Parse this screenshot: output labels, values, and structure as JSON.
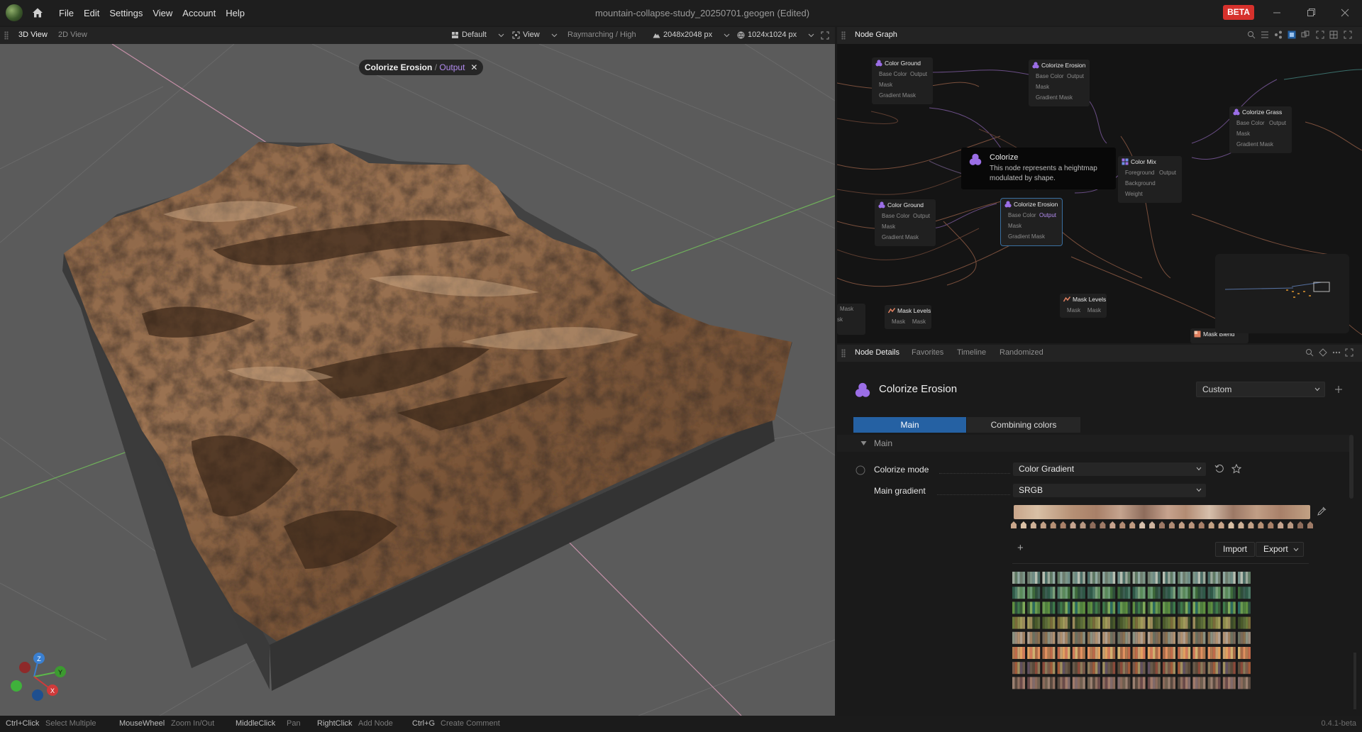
{
  "app": {
    "menu": [
      "File",
      "Edit",
      "Settings",
      "View",
      "Account",
      "Help"
    ],
    "document_title": "mountain-collapse-study_20250701.geogen (Edited)",
    "beta_badge": "BETA",
    "version": "0.4.1-beta"
  },
  "viewport_toolbar": {
    "tabs": [
      "3D View",
      "2D View"
    ],
    "camera_preset": "Default",
    "view_menu": "View",
    "render_mode": "Raymarching / High",
    "terrain_resolution": "2048x2048 px",
    "texture_resolution": "1024x1024 px"
  },
  "viewport": {
    "breadcrumb_node": "Colorize Erosion",
    "breadcrumb_sep": "/",
    "breadcrumb_port": "Output",
    "axes": {
      "z": "Z",
      "y": "Y",
      "x": "X"
    }
  },
  "node_graph": {
    "title": "Node Graph",
    "nodes": [
      {
        "title": "Color Ground",
        "rows": [
          "Base Color",
          "Mask",
          "Gradient Mask"
        ],
        "output": "Output"
      },
      {
        "title": "Colorize Erosion",
        "rows": [
          "Base Color",
          "Mask",
          "Gradient Mask"
        ],
        "output": "Output"
      },
      {
        "title": "Colorize Grass",
        "rows": [
          "Base Color",
          "Mask",
          "Gradient Mask"
        ],
        "output": "Output"
      },
      {
        "title": "Color Mix",
        "rows": [
          "Foreground",
          "Background",
          "Weight"
        ],
        "output": "Output"
      },
      {
        "title": "Color Ground",
        "rows": [
          "Base Color",
          "Mask",
          "Gradient Mask"
        ],
        "output": "Output"
      },
      {
        "title": "Colorize Erosion",
        "rows": [
          "Base Color",
          "Mask",
          "Gradient Mask"
        ],
        "output": "Output"
      },
      {
        "title": "Mask Levels",
        "rows": [
          "Mask"
        ],
        "output": "Mask"
      },
      {
        "title": "Mask Levels",
        "rows": [
          "Mask"
        ],
        "output": "Mask"
      },
      {
        "title": "Mask Blend",
        "rows": [],
        "output": ""
      },
      {
        "title": "",
        "rows": [
          "Mask",
          "sk"
        ],
        "output": ""
      }
    ],
    "tooltip": {
      "title": "Colorize",
      "text": "This node represents a heightmap modulated by shape."
    }
  },
  "details": {
    "tabs": [
      "Node Details",
      "Favorites",
      "Timeline",
      "Randomized"
    ],
    "node_title": "Colorize Erosion",
    "preset": "Custom",
    "sub_tabs": [
      "Main",
      "Combining colors"
    ],
    "section": "Main",
    "props": {
      "colorize_mode_label": "Colorize mode",
      "colorize_mode_value": "Color Gradient",
      "main_gradient_label": "Main gradient",
      "main_gradient_value": "SRGB"
    },
    "add_symbol": "+",
    "import_label": "Import",
    "export_label": "Export"
  },
  "status_hints": [
    {
      "key": "Ctrl+Click",
      "action": "Select Multiple"
    },
    {
      "key": "MouseWheel",
      "action": "Zoom In/Out"
    },
    {
      "key": "MiddleClick",
      "action": "Pan"
    },
    {
      "key": "RightClick",
      "action": "Add Node"
    },
    {
      "key": "Ctrl+G",
      "action": "Create Comment"
    }
  ],
  "colors": {
    "accent": "#2561a3",
    "beta": "#d6312c",
    "port_purple": "#b38cf0",
    "node_icon_purple": "#9b6ee6",
    "terrain": "#8b6647"
  }
}
